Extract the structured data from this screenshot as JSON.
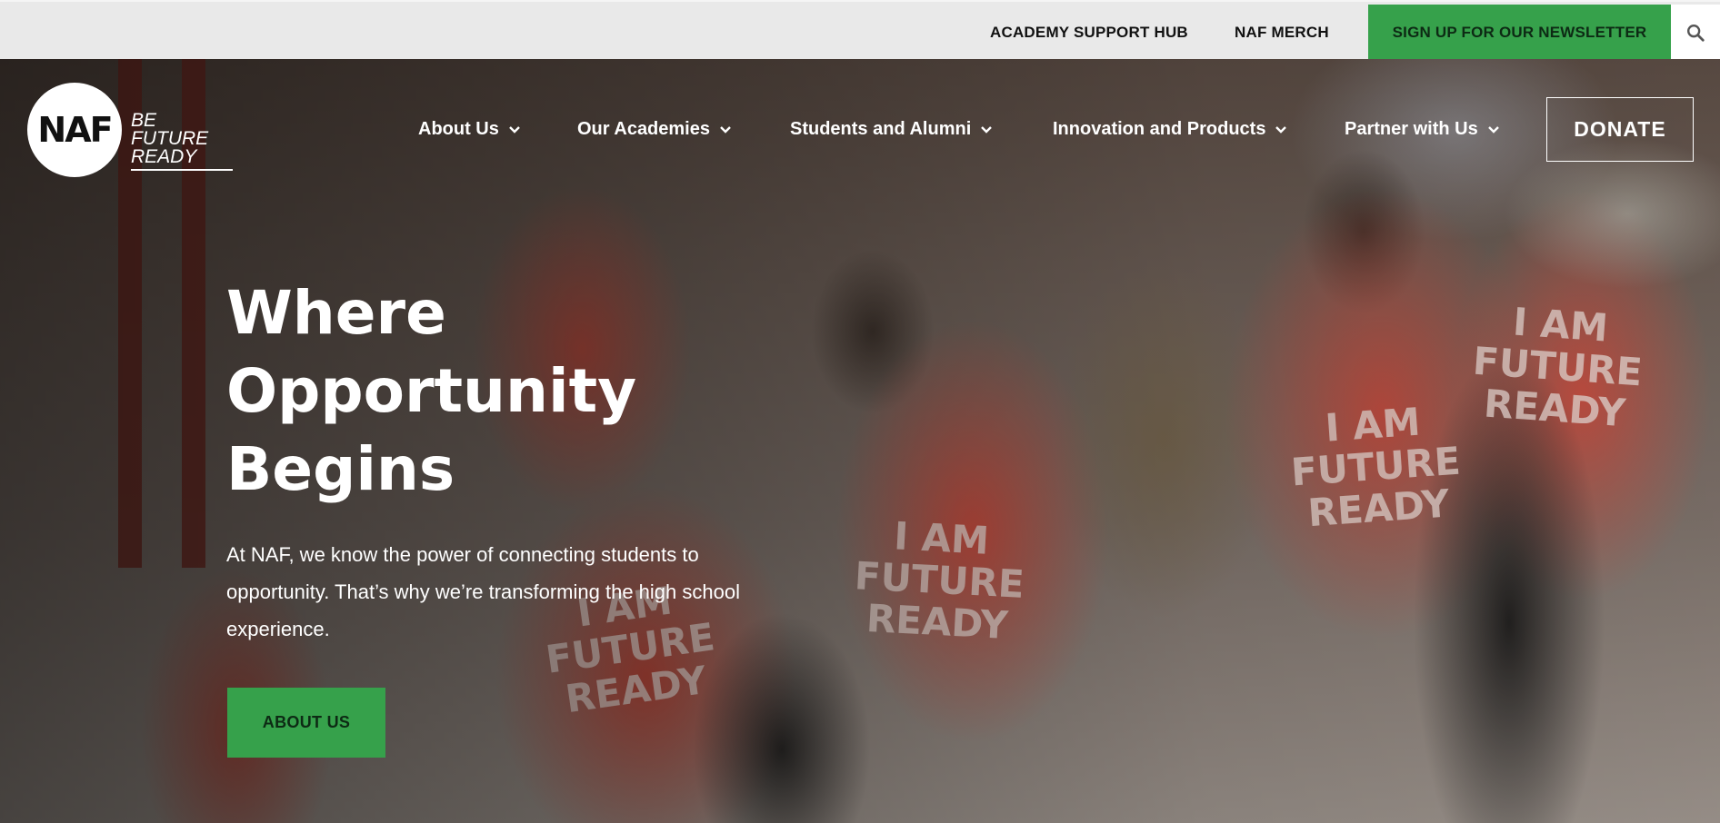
{
  "utility_bar": {
    "support_hub": "ACADEMY SUPPORT HUB",
    "merch": "NAF MERCH",
    "newsletter": "SIGN UP FOR OUR NEWSLETTER",
    "search_icon": "search-icon"
  },
  "header": {
    "logo_mark": "NAF",
    "tagline_line1": "BE FUTURE",
    "tagline_line2": "READY",
    "nav": {
      "about": "About Us",
      "academies": "Our Academies",
      "students": "Students and Alumni",
      "innovation": "Innovation and Products",
      "partner": "Partner with Us"
    },
    "donate": "DONATE"
  },
  "hero": {
    "title_line1": "Where",
    "title_line2": "Opportunity",
    "title_line3": "Begins",
    "body": "At NAF, we know the power of connecting students to opportunity. That’s why we’re transforming the high school experience.",
    "cta": "ABOUT US"
  },
  "colors": {
    "accent_green": "#36a14b",
    "utility_bg": "#e9e9e9",
    "shirt_red": "#d24a3c"
  }
}
